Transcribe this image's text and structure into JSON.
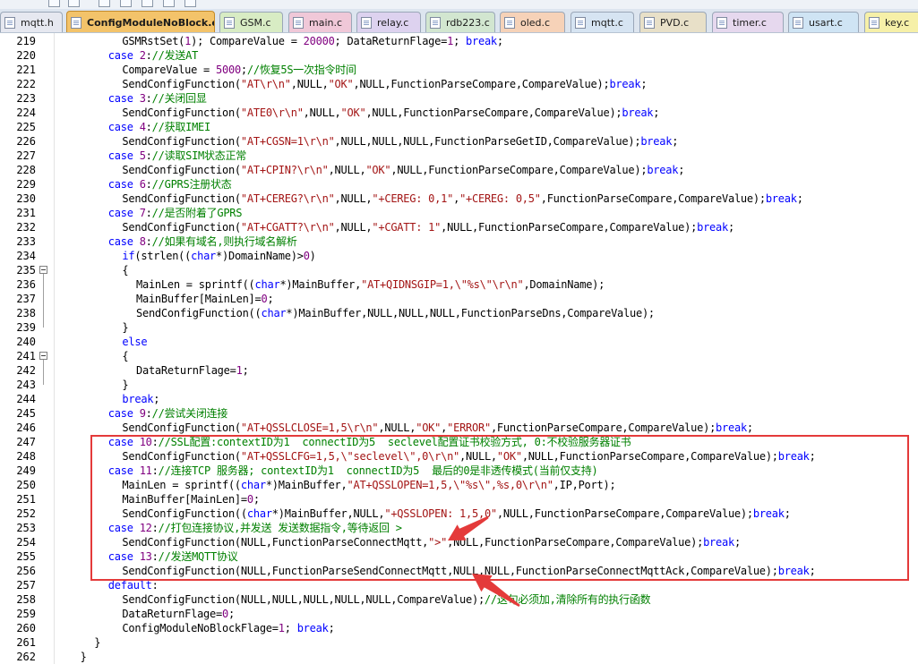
{
  "tabs": [
    {
      "label": "mqtt.h",
      "color": "#e6e8f0",
      "active": false
    },
    {
      "label": "ConfigModuleNoBlock.c",
      "color": "#f3c36a",
      "active": true
    },
    {
      "label": "GSM.c",
      "color": "#d8ecc4",
      "active": false
    },
    {
      "label": "main.c",
      "color": "#f0c8d8",
      "active": false
    },
    {
      "label": "relay.c",
      "color": "#ddd2ef",
      "active": false
    },
    {
      "label": "rdb223.c",
      "color": "#d2e6d0",
      "active": false
    },
    {
      "label": "oled.c",
      "color": "#f6d2b8",
      "active": false
    },
    {
      "label": "mqtt.c",
      "color": "#d6e4f2",
      "active": false
    },
    {
      "label": "PVD.c",
      "color": "#e8e0c8",
      "active": false
    },
    {
      "label": "timer.c",
      "color": "#e6d8ee",
      "active": false
    },
    {
      "label": "usart.c",
      "color": "#cfe4f4",
      "active": false
    },
    {
      "label": "key.c",
      "color": "#f6f0a8",
      "active": false
    }
  ],
  "lines": [
    {
      "n": "219",
      "indent": 8,
      "tokens": [
        {
          "t": "GSMRstSet(",
          "c": ""
        },
        {
          "t": "1",
          "c": "num"
        },
        {
          "t": "); CompareValue = ",
          "c": ""
        },
        {
          "t": "20000",
          "c": "num"
        },
        {
          "t": "; DataReturnFlage=",
          "c": ""
        },
        {
          "t": "1",
          "c": "num"
        },
        {
          "t": "; ",
          "c": ""
        },
        {
          "t": "break",
          "c": "kw"
        },
        {
          "t": ";",
          "c": ""
        }
      ]
    },
    {
      "n": "220",
      "indent": 6,
      "tokens": [
        {
          "t": "case",
          "c": "kw"
        },
        {
          "t": " ",
          "c": ""
        },
        {
          "t": "2",
          "c": "num"
        },
        {
          "t": ":",
          "c": ""
        },
        {
          "t": "//发送AT",
          "c": "cm"
        }
      ]
    },
    {
      "n": "221",
      "indent": 8,
      "tokens": [
        {
          "t": "CompareValue = ",
          "c": ""
        },
        {
          "t": "5000",
          "c": "num"
        },
        {
          "t": ";",
          "c": ""
        },
        {
          "t": "//恢复5S一次指令时间",
          "c": "cm"
        }
      ]
    },
    {
      "n": "222",
      "indent": 8,
      "tokens": [
        {
          "t": "SendConfigFunction(",
          "c": ""
        },
        {
          "t": "\"AT\\r\\n\"",
          "c": "str"
        },
        {
          "t": ",NULL,",
          "c": ""
        },
        {
          "t": "\"OK\"",
          "c": "str"
        },
        {
          "t": ",NULL,FunctionParseCompare,CompareValue);",
          "c": ""
        },
        {
          "t": "break",
          "c": "kw"
        },
        {
          "t": ";",
          "c": ""
        }
      ]
    },
    {
      "n": "223",
      "indent": 6,
      "tokens": [
        {
          "t": "case",
          "c": "kw"
        },
        {
          "t": " ",
          "c": ""
        },
        {
          "t": "3",
          "c": "num"
        },
        {
          "t": ":",
          "c": ""
        },
        {
          "t": "//关闭回显",
          "c": "cm"
        }
      ]
    },
    {
      "n": "224",
      "indent": 8,
      "tokens": [
        {
          "t": "SendConfigFunction(",
          "c": ""
        },
        {
          "t": "\"ATE0\\r\\n\"",
          "c": "str"
        },
        {
          "t": ",NULL,",
          "c": ""
        },
        {
          "t": "\"OK\"",
          "c": "str"
        },
        {
          "t": ",NULL,FunctionParseCompare,CompareValue);",
          "c": ""
        },
        {
          "t": "break",
          "c": "kw"
        },
        {
          "t": ";",
          "c": ""
        }
      ]
    },
    {
      "n": "225",
      "indent": 6,
      "tokens": [
        {
          "t": "case",
          "c": "kw"
        },
        {
          "t": " ",
          "c": ""
        },
        {
          "t": "4",
          "c": "num"
        },
        {
          "t": ":",
          "c": ""
        },
        {
          "t": "//获取IMEI",
          "c": "cm"
        }
      ]
    },
    {
      "n": "226",
      "indent": 8,
      "tokens": [
        {
          "t": "SendConfigFunction(",
          "c": ""
        },
        {
          "t": "\"AT+CGSN=1\\r\\n\"",
          "c": "str"
        },
        {
          "t": ",NULL,NULL,NULL,FunctionParseGetID,CompareValue);",
          "c": ""
        },
        {
          "t": "break",
          "c": "kw"
        },
        {
          "t": ";",
          "c": ""
        }
      ]
    },
    {
      "n": "227",
      "indent": 6,
      "tokens": [
        {
          "t": "case",
          "c": "kw"
        },
        {
          "t": " ",
          "c": ""
        },
        {
          "t": "5",
          "c": "num"
        },
        {
          "t": ":",
          "c": ""
        },
        {
          "t": "//读取SIM状态正常",
          "c": "cm"
        }
      ]
    },
    {
      "n": "228",
      "indent": 8,
      "tokens": [
        {
          "t": "SendConfigFunction(",
          "c": ""
        },
        {
          "t": "\"AT+CPIN?\\r\\n\"",
          "c": "str"
        },
        {
          "t": ",NULL,",
          "c": ""
        },
        {
          "t": "\"OK\"",
          "c": "str"
        },
        {
          "t": ",NULL,FunctionParseCompare,CompareValue);",
          "c": ""
        },
        {
          "t": "break",
          "c": "kw"
        },
        {
          "t": ";",
          "c": ""
        }
      ]
    },
    {
      "n": "229",
      "indent": 6,
      "tokens": [
        {
          "t": "case",
          "c": "kw"
        },
        {
          "t": " ",
          "c": ""
        },
        {
          "t": "6",
          "c": "num"
        },
        {
          "t": ":",
          "c": ""
        },
        {
          "t": "//GPRS注册状态",
          "c": "cm"
        }
      ]
    },
    {
      "n": "230",
      "indent": 8,
      "tokens": [
        {
          "t": "SendConfigFunction(",
          "c": ""
        },
        {
          "t": "\"AT+CEREG?\\r\\n\"",
          "c": "str"
        },
        {
          "t": ",NULL,",
          "c": ""
        },
        {
          "t": "\"+CEREG: 0,1\"",
          "c": "str"
        },
        {
          "t": ",",
          "c": ""
        },
        {
          "t": "\"+CEREG: 0,5\"",
          "c": "str"
        },
        {
          "t": ",FunctionParseCompare,CompareValue);",
          "c": ""
        },
        {
          "t": "break",
          "c": "kw"
        },
        {
          "t": ";",
          "c": ""
        }
      ]
    },
    {
      "n": "231",
      "indent": 6,
      "tokens": [
        {
          "t": "case",
          "c": "kw"
        },
        {
          "t": " ",
          "c": ""
        },
        {
          "t": "7",
          "c": "num"
        },
        {
          "t": ":",
          "c": ""
        },
        {
          "t": "//是否附着了GPRS",
          "c": "cm"
        }
      ]
    },
    {
      "n": "232",
      "indent": 8,
      "tokens": [
        {
          "t": "SendConfigFunction(",
          "c": ""
        },
        {
          "t": "\"AT+CGATT?\\r\\n\"",
          "c": "str"
        },
        {
          "t": ",NULL,",
          "c": ""
        },
        {
          "t": "\"+CGATT: 1\"",
          "c": "str"
        },
        {
          "t": ",NULL,FunctionParseCompare,CompareValue);",
          "c": ""
        },
        {
          "t": "break",
          "c": "kw"
        },
        {
          "t": ";",
          "c": ""
        }
      ]
    },
    {
      "n": "233",
      "indent": 6,
      "tokens": [
        {
          "t": "case",
          "c": "kw"
        },
        {
          "t": " ",
          "c": ""
        },
        {
          "t": "8",
          "c": "num"
        },
        {
          "t": ":",
          "c": ""
        },
        {
          "t": "//如果有域名,则执行域名解析",
          "c": "cm"
        }
      ]
    },
    {
      "n": "234",
      "indent": 8,
      "tokens": [
        {
          "t": "if",
          "c": "kw"
        },
        {
          "t": "(strlen((",
          "c": ""
        },
        {
          "t": "char",
          "c": "kw"
        },
        {
          "t": "*)DomainName)>",
          "c": ""
        },
        {
          "t": "0",
          "c": "num"
        },
        {
          "t": ")",
          "c": ""
        }
      ]
    },
    {
      "n": "235",
      "indent": 8,
      "fold": true,
      "tokens": [
        {
          "t": "{",
          "c": ""
        }
      ]
    },
    {
      "n": "236",
      "indent": 10,
      "tokens": [
        {
          "t": "MainLen = sprintf((",
          "c": ""
        },
        {
          "t": "char",
          "c": "kw"
        },
        {
          "t": "*)MainBuffer,",
          "c": ""
        },
        {
          "t": "\"AT+QIDNSGIP=1,\\\"%s\\\"\\r\\n\"",
          "c": "str"
        },
        {
          "t": ",DomainName);",
          "c": ""
        }
      ]
    },
    {
      "n": "237",
      "indent": 10,
      "tokens": [
        {
          "t": "MainBuffer[MainLen]=",
          "c": ""
        },
        {
          "t": "0",
          "c": "num"
        },
        {
          "t": ";",
          "c": ""
        }
      ]
    },
    {
      "n": "238",
      "indent": 10,
      "tokens": [
        {
          "t": "SendConfigFunction((",
          "c": ""
        },
        {
          "t": "char",
          "c": "kw"
        },
        {
          "t": "*)MainBuffer,NULL,NULL,NULL,FunctionParseDns,CompareValue);",
          "c": ""
        }
      ]
    },
    {
      "n": "239",
      "indent": 8,
      "tokens": [
        {
          "t": "}",
          "c": ""
        }
      ]
    },
    {
      "n": "240",
      "indent": 8,
      "tokens": [
        {
          "t": "else",
          "c": "kw"
        }
      ]
    },
    {
      "n": "241",
      "indent": 8,
      "fold": true,
      "tokens": [
        {
          "t": "{",
          "c": ""
        }
      ]
    },
    {
      "n": "242",
      "indent": 10,
      "tokens": [
        {
          "t": "DataReturnFlage=",
          "c": ""
        },
        {
          "t": "1",
          "c": "num"
        },
        {
          "t": ";",
          "c": ""
        }
      ]
    },
    {
      "n": "243",
      "indent": 8,
      "tokens": [
        {
          "t": "}",
          "c": ""
        }
      ]
    },
    {
      "n": "244",
      "indent": 8,
      "tokens": [
        {
          "t": "break",
          "c": "kw"
        },
        {
          "t": ";",
          "c": ""
        }
      ]
    },
    {
      "n": "245",
      "indent": 6,
      "tokens": [
        {
          "t": "case",
          "c": "kw"
        },
        {
          "t": " ",
          "c": ""
        },
        {
          "t": "9",
          "c": "num"
        },
        {
          "t": ":",
          "c": ""
        },
        {
          "t": "//尝试关闭连接",
          "c": "cm"
        }
      ]
    },
    {
      "n": "246",
      "indent": 8,
      "tokens": [
        {
          "t": "SendConfigFunction(",
          "c": ""
        },
        {
          "t": "\"AT+QSSLCLOSE=1,5\\r\\n\"",
          "c": "str"
        },
        {
          "t": ",NULL,",
          "c": ""
        },
        {
          "t": "\"OK\"",
          "c": "str"
        },
        {
          "t": ",",
          "c": ""
        },
        {
          "t": "\"ERROR\"",
          "c": "str"
        },
        {
          "t": ",FunctionParseCompare,CompareValue);",
          "c": ""
        },
        {
          "t": "break",
          "c": "kw"
        },
        {
          "t": ";",
          "c": ""
        }
      ]
    },
    {
      "n": "247",
      "indent": 6,
      "tokens": [
        {
          "t": "case",
          "c": "kw"
        },
        {
          "t": " ",
          "c": ""
        },
        {
          "t": "10",
          "c": "num"
        },
        {
          "t": ":",
          "c": ""
        },
        {
          "t": "//SSL配置:contextID为1  connectID为5  seclevel配置证书校验方式, 0:不校验服务器证书",
          "c": "cm"
        }
      ]
    },
    {
      "n": "248",
      "indent": 8,
      "tokens": [
        {
          "t": "SendConfigFunction(",
          "c": ""
        },
        {
          "t": "\"AT+QSSLCFG=1,5,\\\"seclevel\\\",0\\r\\n\"",
          "c": "str"
        },
        {
          "t": ",NULL,",
          "c": ""
        },
        {
          "t": "\"OK\"",
          "c": "str"
        },
        {
          "t": ",NULL,FunctionParseCompare,CompareValue);",
          "c": ""
        },
        {
          "t": "break",
          "c": "kw"
        },
        {
          "t": ";",
          "c": ""
        }
      ]
    },
    {
      "n": "249",
      "indent": 6,
      "tokens": [
        {
          "t": "case",
          "c": "kw"
        },
        {
          "t": " ",
          "c": ""
        },
        {
          "t": "11",
          "c": "num"
        },
        {
          "t": ":",
          "c": ""
        },
        {
          "t": "//连接TCP 服务器; contextID为1  connectID为5  最后的0是非透传模式(当前仅支持)",
          "c": "cm"
        }
      ]
    },
    {
      "n": "250",
      "indent": 8,
      "tokens": [
        {
          "t": "MainLen = sprintf((",
          "c": ""
        },
        {
          "t": "char",
          "c": "kw"
        },
        {
          "t": "*)MainBuffer,",
          "c": ""
        },
        {
          "t": "\"AT+QSSLOPEN=1,5,\\\"%s\\\",%s,0\\r\\n\"",
          "c": "str"
        },
        {
          "t": ",IP,Port);",
          "c": ""
        }
      ]
    },
    {
      "n": "251",
      "indent": 8,
      "tokens": [
        {
          "t": "MainBuffer[MainLen]=",
          "c": ""
        },
        {
          "t": "0",
          "c": "num"
        },
        {
          "t": ";",
          "c": ""
        }
      ]
    },
    {
      "n": "252",
      "indent": 8,
      "tokens": [
        {
          "t": "SendConfigFunction((",
          "c": ""
        },
        {
          "t": "char",
          "c": "kw"
        },
        {
          "t": "*)MainBuffer,NULL,",
          "c": ""
        },
        {
          "t": "\"+QSSLOPEN: 1,5,0\"",
          "c": "str"
        },
        {
          "t": ",NULL,FunctionParseCompare,CompareValue);",
          "c": ""
        },
        {
          "t": "break",
          "c": "kw"
        },
        {
          "t": ";",
          "c": ""
        }
      ]
    },
    {
      "n": "253",
      "indent": 6,
      "tokens": [
        {
          "t": "case",
          "c": "kw"
        },
        {
          "t": " ",
          "c": ""
        },
        {
          "t": "12",
          "c": "num"
        },
        {
          "t": ":",
          "c": ""
        },
        {
          "t": "//打包连接协议,并发送 发送数据指令,等待返回 >",
          "c": "cm"
        }
      ]
    },
    {
      "n": "254",
      "indent": 8,
      "tokens": [
        {
          "t": "SendConfigFunction(NULL,FunctionParseConnectMqtt,",
          "c": ""
        },
        {
          "t": "\">\"",
          "c": "str"
        },
        {
          "t": ",NULL,FunctionParseCompare,CompareValue);",
          "c": ""
        },
        {
          "t": "break",
          "c": "kw"
        },
        {
          "t": ";",
          "c": ""
        }
      ]
    },
    {
      "n": "255",
      "indent": 6,
      "tokens": [
        {
          "t": "case",
          "c": "kw"
        },
        {
          "t": " ",
          "c": ""
        },
        {
          "t": "13",
          "c": "num"
        },
        {
          "t": ":",
          "c": ""
        },
        {
          "t": "//发送MQTT协议",
          "c": "cm"
        }
      ]
    },
    {
      "n": "256",
      "indent": 8,
      "tokens": [
        {
          "t": "SendConfigFunction(NULL,FunctionParseSendConnectMqtt,NULL,NULL,FunctionParseConnectMqttAck,CompareValue);",
          "c": ""
        },
        {
          "t": "break",
          "c": "kw"
        },
        {
          "t": ";",
          "c": ""
        }
      ]
    },
    {
      "n": "257",
      "indent": 6,
      "tokens": [
        {
          "t": "default",
          "c": "kw"
        },
        {
          "t": ":",
          "c": ""
        }
      ]
    },
    {
      "n": "258",
      "indent": 8,
      "tokens": [
        {
          "t": "SendConfigFunction(NULL,NULL,NULL,NULL,NULL,CompareValue);",
          "c": ""
        },
        {
          "t": "//这句必须加,清除所有的执行函数",
          "c": "cm"
        }
      ]
    },
    {
      "n": "259",
      "indent": 8,
      "tokens": [
        {
          "t": "DataReturnFlage=",
          "c": ""
        },
        {
          "t": "0",
          "c": "num"
        },
        {
          "t": ";",
          "c": ""
        }
      ]
    },
    {
      "n": "260",
      "indent": 8,
      "tokens": [
        {
          "t": "ConfigModuleNoBlockFlage=",
          "c": ""
        },
        {
          "t": "1",
          "c": "num"
        },
        {
          "t": "; ",
          "c": ""
        },
        {
          "t": "break",
          "c": "kw"
        },
        {
          "t": ";",
          "c": ""
        }
      ]
    },
    {
      "n": "261",
      "indent": 4,
      "tokens": [
        {
          "t": "}",
          "c": ""
        }
      ]
    },
    {
      "n": "262",
      "indent": 2,
      "tokens": [
        {
          "t": "}",
          "c": ""
        }
      ]
    }
  ],
  "annotations": {
    "box_color": "#e43a3a",
    "arrow_color": "#e43a3a"
  },
  "icons": {
    "tab_file": "file-icon",
    "fold": "fold-minus-icon"
  }
}
